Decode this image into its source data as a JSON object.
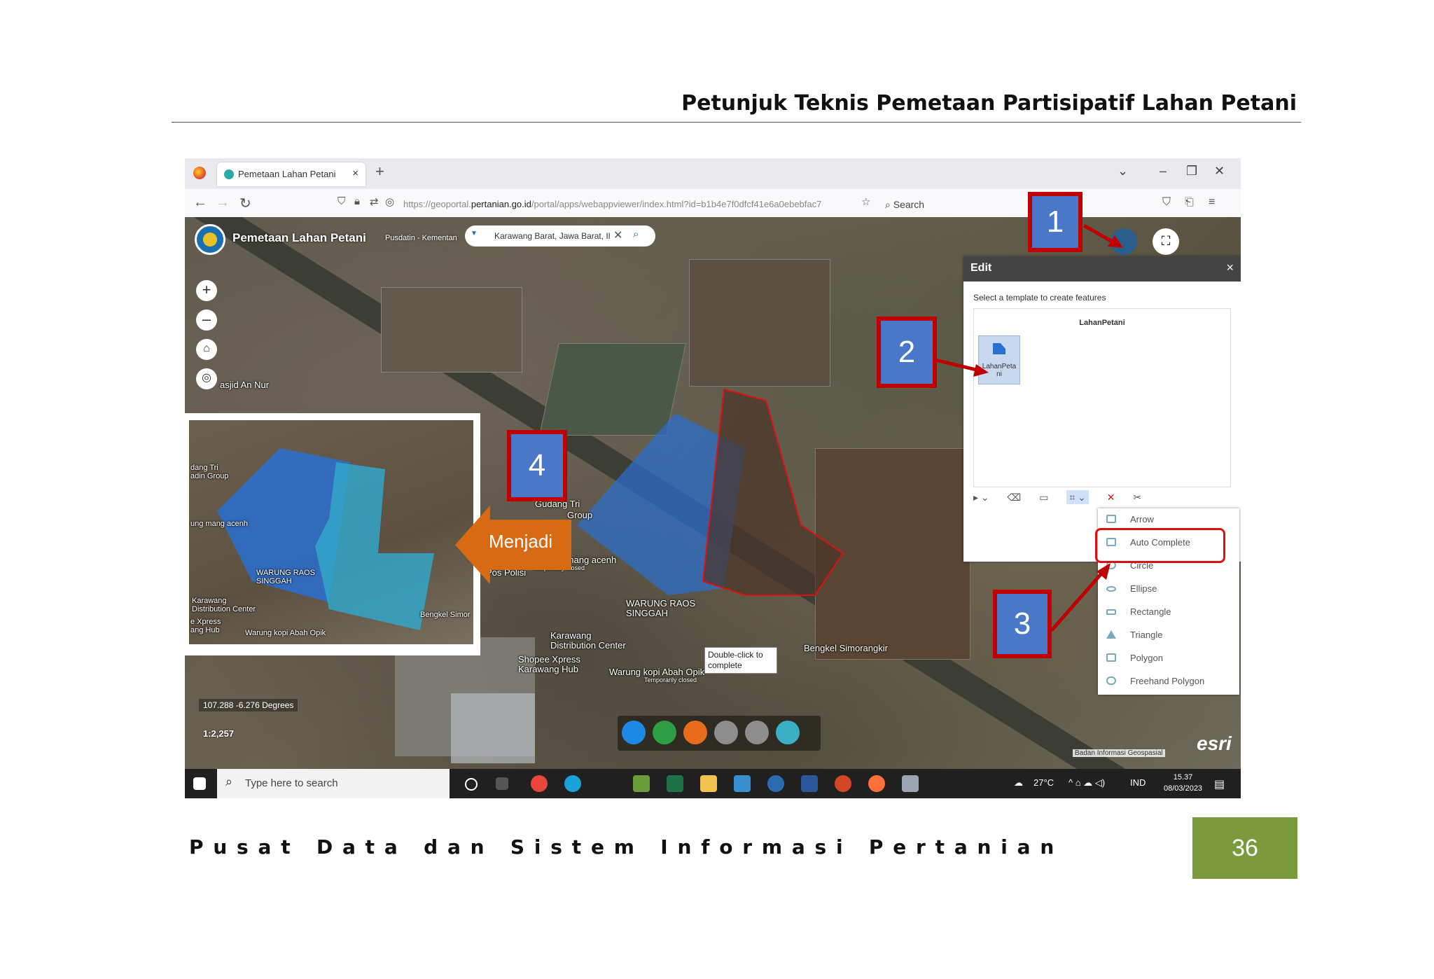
{
  "header": {
    "title": "Petunjuk Teknis Pemetaan Partisipatif Lahan Petani"
  },
  "footer": {
    "org": "Pusat Data dan Sistem Informasi Pertanian",
    "page": "36"
  },
  "browser": {
    "tab_title": "Pemetaan Lahan Petani",
    "url_prefix": "https://geoportal.",
    "url_domain": "pertanian.go.id",
    "url_path": "/portal/apps/webappviewer/index.html?id=b1b4e7f0dfcf41e6a0ebebfac7",
    "search_label": "Search"
  },
  "app": {
    "title": "Pemetaan Lahan Petani",
    "subtitle": "Pusdatin - Kementan",
    "search_value": "Karawang Barat, Jawa Barat, Il"
  },
  "map": {
    "labels": [
      "asjid An Nur",
      "Gudang Tri",
      "Group",
      "Warung mang acenh",
      "Temporarily closed",
      "Pos Polisi",
      "WARUNG RAOS",
      "SINGGAH",
      "Karawang",
      "Distribution Center",
      "Shopee Xpress",
      "Karawang Hub",
      "Warung kopi Abah Opik",
      "Temporarily closed",
      "Bengkel Simorangkir"
    ],
    "coords": "107.288 -6.276 Degrees",
    "scale": "1:2,257",
    "tooltip": "Double-click to complete",
    "attribution": "Badan Informasi Geospasial",
    "esri": "esri"
  },
  "edit_panel": {
    "title": "Edit",
    "hint": "Select a template to create features",
    "layer": "LahanPetani",
    "template": "LahanPeta ni"
  },
  "draw_menu": [
    "Arrow",
    "Auto Complete",
    "Circle",
    "Ellipse",
    "Rectangle",
    "Triangle",
    "Polygon",
    "Freehand Polygon"
  ],
  "callouts": [
    "1",
    "2",
    "3",
    "4"
  ],
  "arrow_label": "Menjadi",
  "inset_labels": [
    "dang Tri",
    "adin Group",
    "ung mang acenh",
    "WARUNG RAOS",
    "SINGGAH",
    "Karawang",
    "Distribution Center",
    "e Xpress",
    "ang Hub",
    "Warung kopi Abah Opik",
    "Bengkel Simor"
  ],
  "taskbar": {
    "search": "Type here to search",
    "temp": "27°C",
    "lang": "IND",
    "time": "15.37",
    "date": "08/03/2023"
  },
  "colors": {
    "accent": "#4a78c8",
    "callout_border": "#c00000",
    "page_badge": "#7a9a3c",
    "arrow": "#d96a14"
  }
}
